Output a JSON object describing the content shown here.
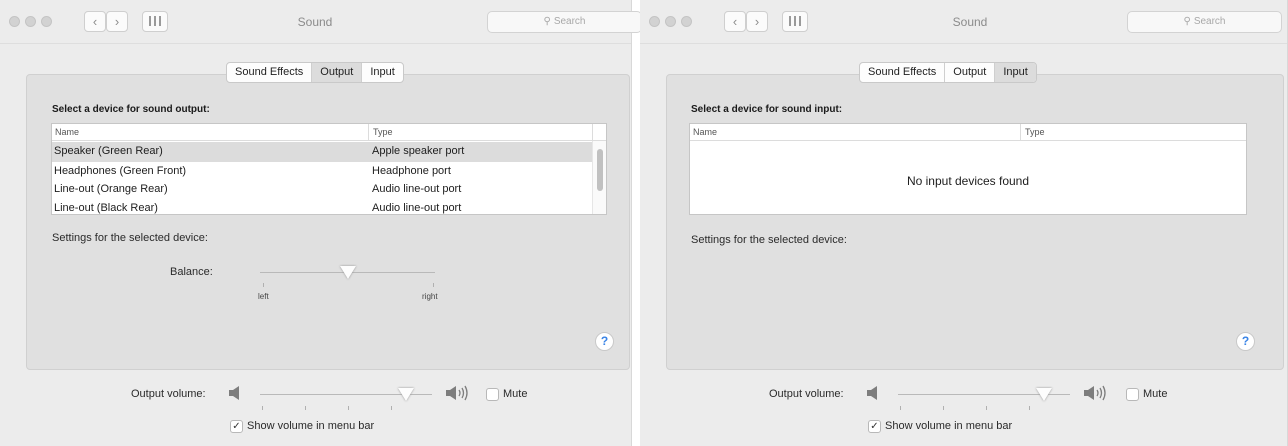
{
  "left_window": {
    "title": "Sound",
    "search_placeholder": "Search",
    "nav_back": "‹",
    "nav_forward": "›",
    "grid_icon": "grid-icon",
    "tabs": [
      {
        "label": "Sound Effects",
        "selected": false
      },
      {
        "label": "Output",
        "selected": true
      },
      {
        "label": "Input",
        "selected": false
      }
    ],
    "section_title": "Select a device for sound output:",
    "table": {
      "columns": [
        "Name",
        "Type"
      ],
      "rows": [
        {
          "name": "Speaker (Green Rear)",
          "type": "Apple speaker port",
          "selected": true
        },
        {
          "name": "Headphones (Green Front)",
          "type": "Headphone port",
          "selected": false
        },
        {
          "name": "Line-out (Orange Rear)",
          "type": "Audio line-out port",
          "selected": false
        },
        {
          "name": "Line-out (Black Rear)",
          "type": "Audio line-out port",
          "selected": false
        }
      ]
    },
    "settings_label": "Settings for the selected device:",
    "balance": {
      "label": "Balance:",
      "left_label": "left",
      "right_label": "right",
      "value": 0.5
    },
    "help_label": "?",
    "output_volume": {
      "label": "Output volume:",
      "value": 0.85,
      "mute_label": "Mute",
      "mute_checked": false
    },
    "show_volume": {
      "label": "Show volume in menu bar",
      "checked": true,
      "check_mark": "✓"
    }
  },
  "right_window": {
    "title": "Sound",
    "search_placeholder": "Search",
    "nav_back": "‹",
    "nav_forward": "›",
    "grid_icon": "grid-icon",
    "tabs": [
      {
        "label": "Sound Effects",
        "selected": false
      },
      {
        "label": "Output",
        "selected": false
      },
      {
        "label": "Input",
        "selected": true
      }
    ],
    "section_title": "Select a device for sound input:",
    "table": {
      "columns": [
        "Name",
        "Type"
      ],
      "empty_message": "No input devices found"
    },
    "settings_label": "Settings for the selected device:",
    "help_label": "?",
    "output_volume": {
      "label": "Output volume:",
      "value": 0.85,
      "mute_label": "Mute",
      "mute_checked": false
    },
    "show_volume": {
      "label": "Show volume in menu bar",
      "checked": true,
      "check_mark": "✓"
    }
  },
  "colors": {
    "window_bg": "#ececec",
    "panel_bg": "#e0e0e0",
    "selected_row": "#dcdcdc",
    "help_accent": "#3a84e6"
  }
}
